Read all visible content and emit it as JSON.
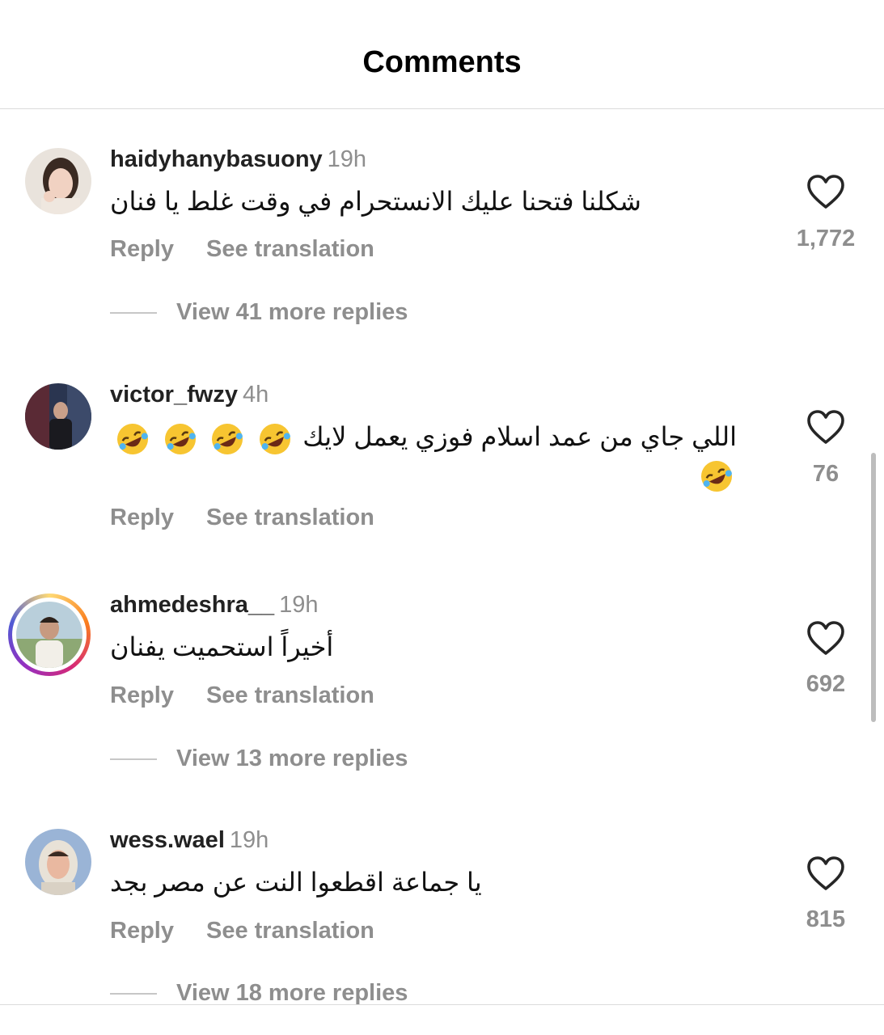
{
  "header": {
    "title": "Comments"
  },
  "comments": [
    {
      "username": "haidyhanybasuony",
      "time": "19h",
      "text": "شكلنا فتحنا عليك الانستحرام في وقت غلط يا فنان",
      "reply_label": "Reply",
      "translate_label": "See translation",
      "likes": "1,772",
      "more_replies": "View 41 more replies"
    },
    {
      "username": "victor_fwzy",
      "time": "4h",
      "text": "اللي جاي من عمد اسلام فوزي يعمل لايك",
      "emoji_name": "rolling-on-the-floor-laughing",
      "reply_label": "Reply",
      "translate_label": "See translation",
      "likes": "76"
    },
    {
      "username": "ahmedeshra__",
      "time": "19h",
      "text": "أخيراً استحميت يفنان",
      "reply_label": "Reply",
      "translate_label": "See translation",
      "likes": "692",
      "more_replies": "View 13 more replies"
    },
    {
      "username": "wess.wael",
      "time": "19h",
      "text": "يا جماعة اقطعوا النت عن مصر بجد",
      "reply_label": "Reply",
      "translate_label": "See translation",
      "likes": "815",
      "more_replies": "View 18 more replies"
    }
  ],
  "colors": {
    "secondary_text": "#8e8e8e",
    "divider": "#dbdbdb",
    "story_ring": "#d62976"
  }
}
